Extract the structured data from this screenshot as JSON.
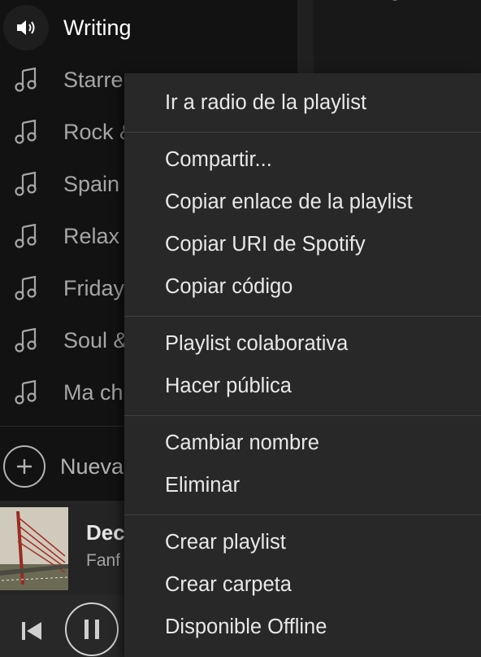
{
  "sidebar": {
    "playlists": [
      {
        "label": "Writing",
        "icon": "speaker-icon",
        "active": true
      },
      {
        "label": "Starre",
        "icon": "music-note-icon"
      },
      {
        "label": "Rock &",
        "icon": "music-note-icon"
      },
      {
        "label": "Spain",
        "icon": "music-note-icon"
      },
      {
        "label": "Relax",
        "icon": "music-note-icon"
      },
      {
        "label": "Friday",
        "icon": "music-note-icon"
      },
      {
        "label": "Soul &",
        "icon": "music-note-icon"
      },
      {
        "label": "Ma ch",
        "icon": "music-note-icon"
      }
    ],
    "new_playlist_label": "Nueva"
  },
  "now_playing": {
    "title": "Dec",
    "artist": "Fanf"
  },
  "context_menu": {
    "groups": [
      [
        "Ir a radio de la playlist"
      ],
      [
        "Compartir...",
        "Copiar enlace de la playlist",
        "Copiar URI de Spotify",
        "Copiar código"
      ],
      [
        "Playlist colaborativa",
        "Hacer pública"
      ],
      [
        "Cambiar nombre",
        "Eliminar"
      ],
      [
        "Crear playlist",
        "Crear carpeta",
        "Disponible Offline"
      ]
    ]
  },
  "colors": {
    "background": "#181818",
    "sidebar": "#121212",
    "menu_background": "#282828",
    "menu_text": "#e8e8e8",
    "inactive_text": "#a6a6a6"
  }
}
